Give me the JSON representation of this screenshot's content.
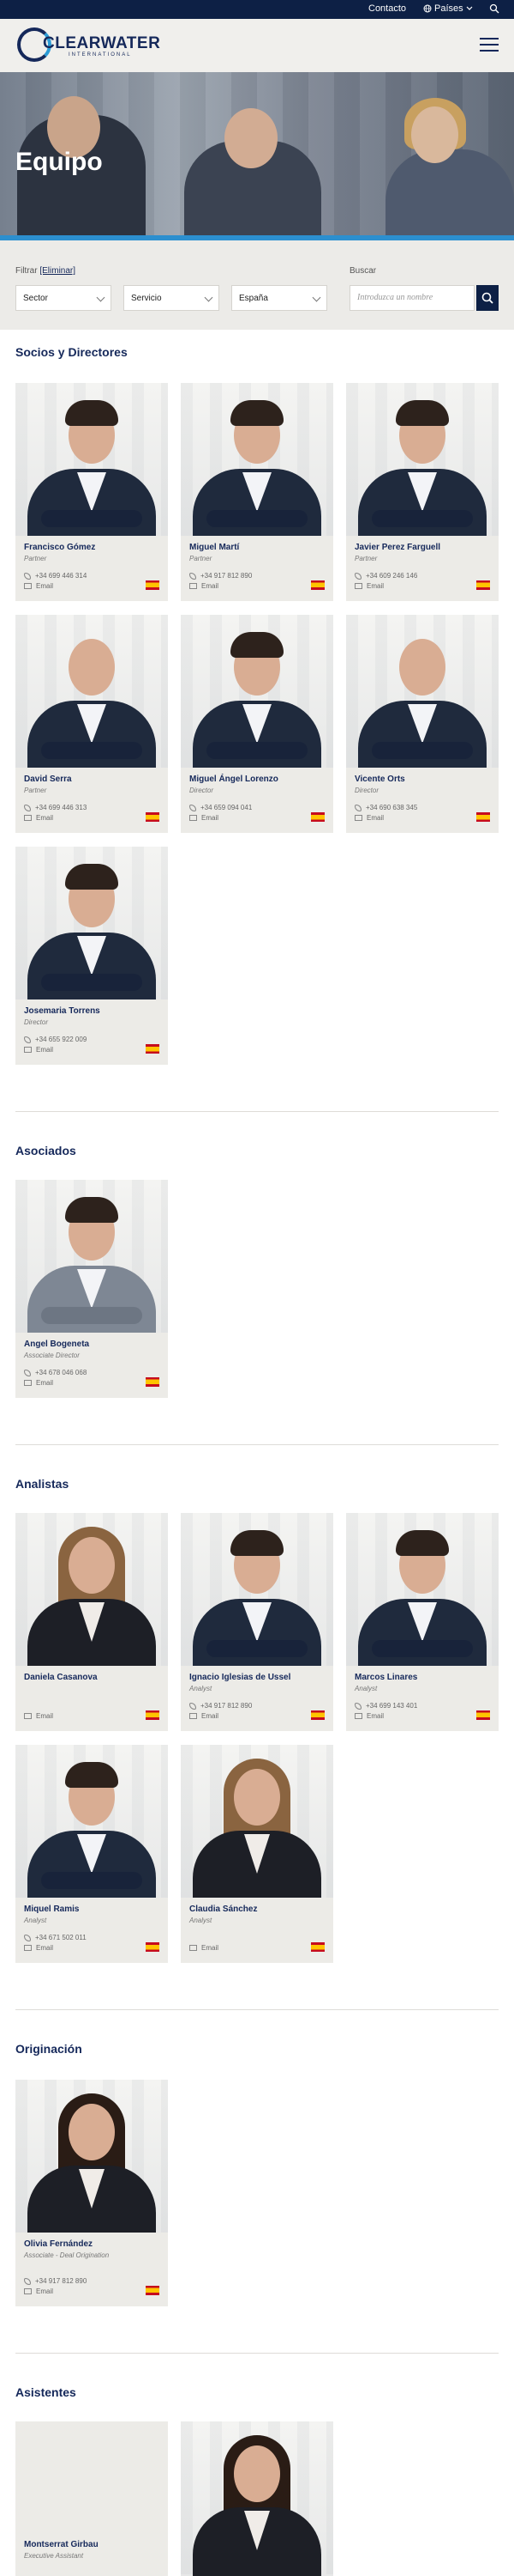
{
  "topbar": {
    "contact": "Contacto",
    "countries": "Países"
  },
  "logo": {
    "word": "CLEARWATER",
    "sub": "INTERNATIONAL"
  },
  "hero": {
    "title": "Equipo"
  },
  "filters": {
    "label": "Filtrar",
    "clear": "[Eliminar]",
    "sector": "Sector",
    "service": "Servicio",
    "country": "España",
    "search_label": "Buscar",
    "search_placeholder": "Introduzca un nombre"
  },
  "sections": {
    "partners": "Socios y Directores",
    "associates": "Asociados",
    "analysts": "Analistas",
    "origination": "Originación",
    "assistants": "Asistentes"
  },
  "partners": [
    {
      "name": "Francisco Gómez",
      "role": "Partner",
      "phone": "+34 699 446 314",
      "email": "Email"
    },
    {
      "name": "Miguel Martí",
      "role": "Partner",
      "phone": "+34 917 812 890",
      "email": "Email"
    },
    {
      "name": "Javier Perez Farguell",
      "role": "Partner",
      "phone": "+34 609 246 146",
      "email": "Email"
    },
    {
      "name": "David Serra",
      "role": "Partner",
      "phone": "+34 699 446 313",
      "email": "Email"
    },
    {
      "name": "Miguel Ángel Lorenzo",
      "role": "Director",
      "phone": "+34 659 094 041",
      "email": "Email"
    },
    {
      "name": "Vicente Orts",
      "role": "Director",
      "phone": "+34 690 638 345",
      "email": "Email"
    },
    {
      "name": "Josemaria Torrens",
      "role": "Director",
      "phone": "+34 655 922 009",
      "email": "Email"
    }
  ],
  "associates": [
    {
      "name": "Angel Bogeneta",
      "role": "Associate Director",
      "phone": "+34 678 046 068",
      "email": "Email"
    }
  ],
  "analysts": [
    {
      "name": "Daniela Casanova",
      "role": "",
      "phone": "",
      "email": "Email"
    },
    {
      "name": "Ignacio Iglesias de Ussel",
      "role": "Analyst",
      "phone": "+34 917 812 890",
      "email": "Email"
    },
    {
      "name": "Marcos Linares",
      "role": "Analyst",
      "phone": "+34 699 143 401",
      "email": "Email"
    },
    {
      "name": "Miquel Ramis",
      "role": "Analyst",
      "phone": "+34 671 502 011",
      "email": "Email"
    },
    {
      "name": "Claudia Sánchez",
      "role": "Analyst",
      "phone": "",
      "email": "Email"
    }
  ],
  "origination": [
    {
      "name": "Olivia Fernández",
      "role": "Associate - Deal Origination",
      "phone": "+34 917 812 890",
      "email": "Email"
    }
  ],
  "assistants": [
    {
      "name": "Montserrat Girbau",
      "role": "Executive Assistant"
    }
  ]
}
